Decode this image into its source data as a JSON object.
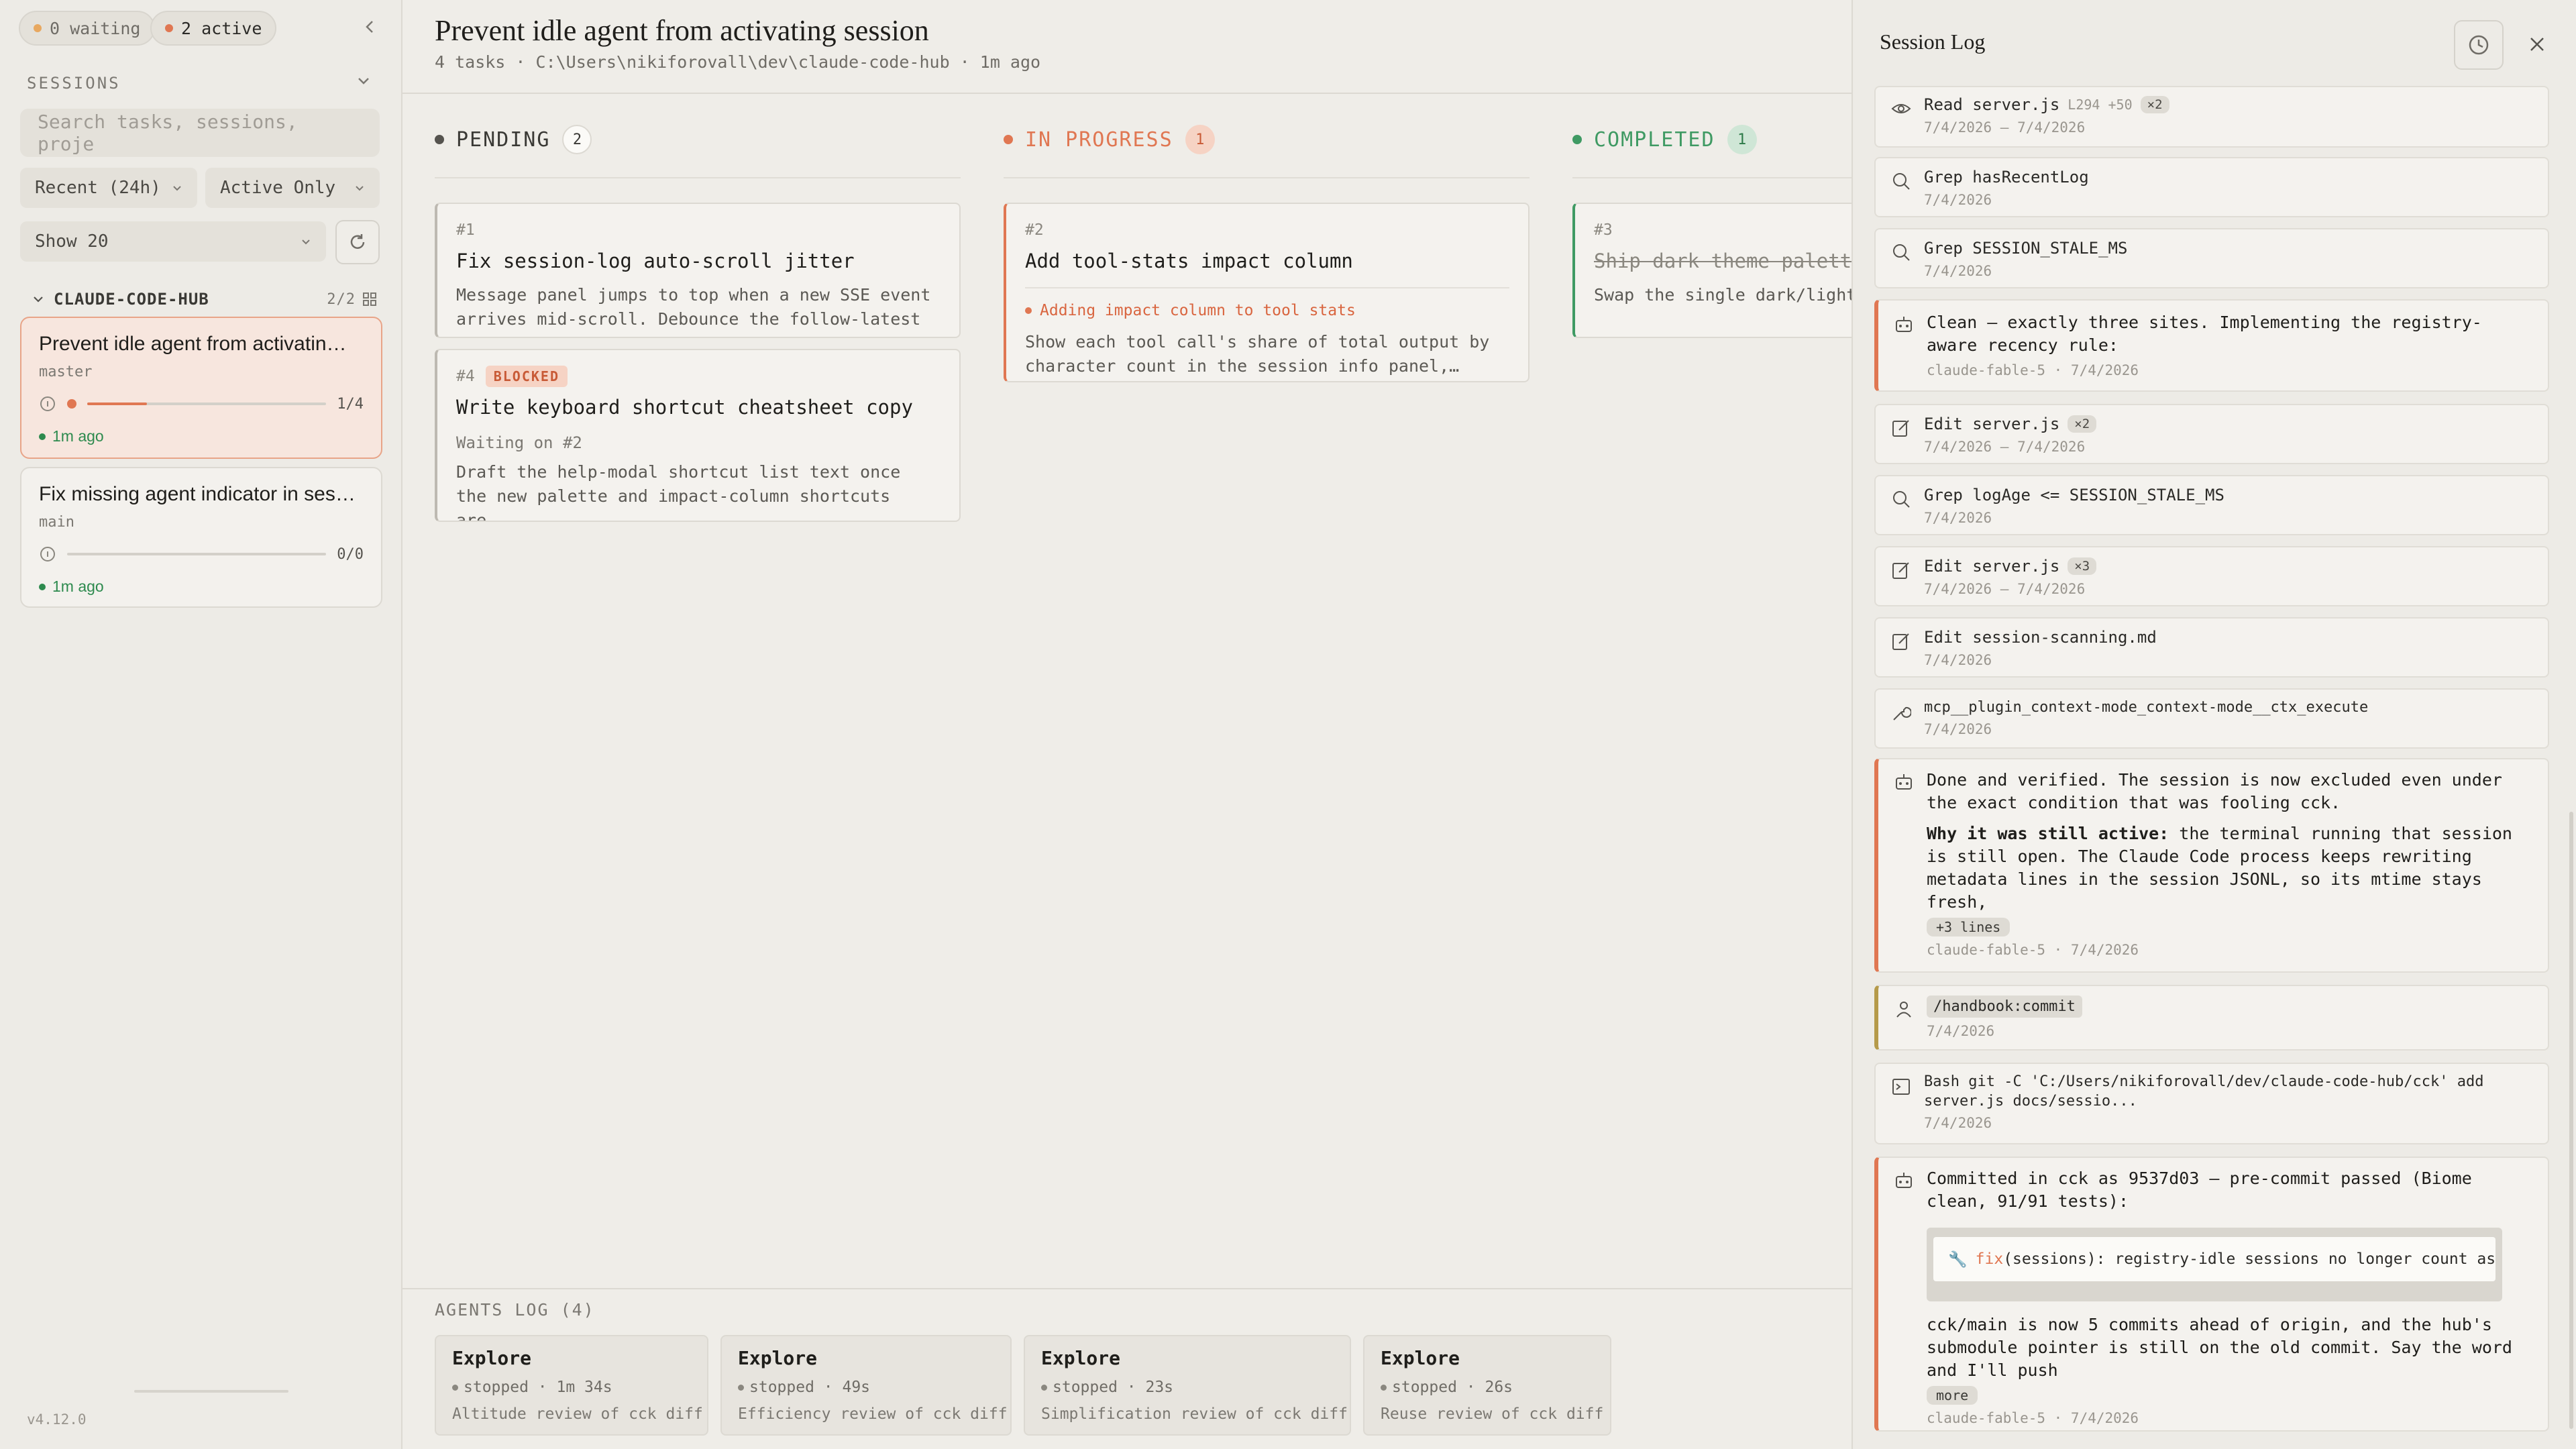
{
  "sidebar": {
    "waiting_pill": "0 waiting",
    "active_pill": "2 active",
    "sessions_label": "SESSIONS",
    "search_placeholder": "Search tasks, sessions, proje",
    "filter_recent": "Recent (24h)",
    "filter_active": "Active Only",
    "show_count": "Show 20",
    "group": {
      "name": "CLAUDE-CODE-HUB",
      "count": "2/2"
    },
    "sessions": [
      {
        "title": "Prevent idle agent from activatin…",
        "branch": "master",
        "progress": "1/4",
        "progress_fraction": 0.25,
        "time": "1m ago"
      },
      {
        "title": "Fix missing agent indicator in ses…",
        "branch": "main",
        "progress": "0/0",
        "progress_fraction": 0,
        "time": "1m ago"
      }
    ],
    "version": "v4.12.0"
  },
  "main": {
    "title": "Prevent idle agent from activating session",
    "meta": "4 tasks · C:\\Users\\nikiforovall\\dev\\claude-code-hub · 1m ago",
    "columns": [
      {
        "label": "PENDING",
        "count": "2",
        "color": "#55534e"
      },
      {
        "label": "IN PROGRESS",
        "count": "1",
        "color": "#e07752"
      },
      {
        "label": "COMPLETED",
        "count": "1",
        "color": "#3f9a63"
      }
    ],
    "tasks": {
      "t1": {
        "num": "#1",
        "title": "Fix session-log auto-scroll jitter",
        "desc": "Message panel jumps to top when a new SSE event arrives mid-scroll. Debounce the follow-latest re…"
      },
      "t4": {
        "num": "#4",
        "badge": "BLOCKED",
        "title": "Write keyboard shortcut cheatsheet copy",
        "wait": "Waiting on #2",
        "desc": "Draft the help-modal shortcut list text once the new palette and impact-column shortcuts are…"
      },
      "t2": {
        "num": "#2",
        "title": "Add tool-stats impact column",
        "active": "Adding impact column to tool stats",
        "desc": "Show each tool call's share of total output by character count in the session info panel,…"
      },
      "t3": {
        "num": "#3",
        "title": "Ship dark theme palette p",
        "desc": "Swap the single dark/light accent themes, persisted pe"
      }
    },
    "agents_label": "AGENTS LOG (4)",
    "agents": [
      {
        "name": "Explore",
        "status": "stopped · 1m 34s",
        "desc": "Altitude review of cck diff"
      },
      {
        "name": "Explore",
        "status": "stopped · 49s",
        "desc": "Efficiency review of cck diff"
      },
      {
        "name": "Explore",
        "status": "stopped · 23s",
        "desc": "Simplification review of cck diff"
      },
      {
        "name": "Explore",
        "status": "stopped · 26s",
        "desc": "Reuse review of cck diff"
      }
    ]
  },
  "log": {
    "title": "Session Log",
    "e1": {
      "text": "Read server.js",
      "sub": "L294 +50",
      "badge": "×2",
      "date": "7/4/2026 – 7/4/2026"
    },
    "e2": {
      "text": "Grep hasRecentLog",
      "date": "7/4/2026"
    },
    "e3": {
      "text": "Grep SESSION_STALE_MS",
      "date": "7/4/2026"
    },
    "e4": {
      "text": "Clean — exactly three sites. Implementing the registry-aware recency rule:",
      "meta": "claude-fable-5 · 7/4/2026"
    },
    "e5": {
      "text": "Edit server.js",
      "badge": "×2",
      "date": "7/4/2026 – 7/4/2026"
    },
    "e6": {
      "text": "Grep logAge <= SESSION_STALE_MS",
      "date": "7/4/2026"
    },
    "e7": {
      "text": "Edit server.js",
      "badge": "×3",
      "date": "7/4/2026 – 7/4/2026"
    },
    "e8": {
      "text": "Edit session-scanning.md",
      "date": "7/4/2026"
    },
    "e9": {
      "text": "mcp__plugin_context-mode_context-mode__ctx_execute",
      "date": "7/4/2026"
    },
    "e10": {
      "p1": "Done and verified. The session is now excluded even under the exact condition that was fooling cck.",
      "bold": "Why it was still active:",
      "p2": " the terminal running that session is still open. The Claude Code process keeps rewriting metadata lines in the session JSONL, so its mtime stays fresh,",
      "chip": "+3 lines",
      "meta": "claude-fable-5 · 7/4/2026"
    },
    "e11": {
      "cmd": "/handbook:commit",
      "date": "7/4/2026"
    },
    "e12": {
      "l1": "Bash git -C 'C:/Users/nikiforovall/dev/claude-code-hub/cck' add",
      "l2": "server.js docs/sessio...",
      "date": "7/4/2026"
    },
    "e13": {
      "p1": "Committed in cck as 9537d03 — pre-commit passed (Biome clean, 91/91 tests):",
      "commit_type": "fix",
      "commit_msg": "(sessions): registry-idle sessions no longer count as active",
      "p2": "cck/main is now 5 commits ahead of origin, and the hub's submodule pointer is still on the old commit. Say the word and I'll push",
      "chip": "more",
      "meta": "claude-fable-5 · 7/4/2026"
    }
  },
  "colors": {
    "accent": "#e07752",
    "success": "#3f9a63",
    "pending": "#55534e"
  }
}
